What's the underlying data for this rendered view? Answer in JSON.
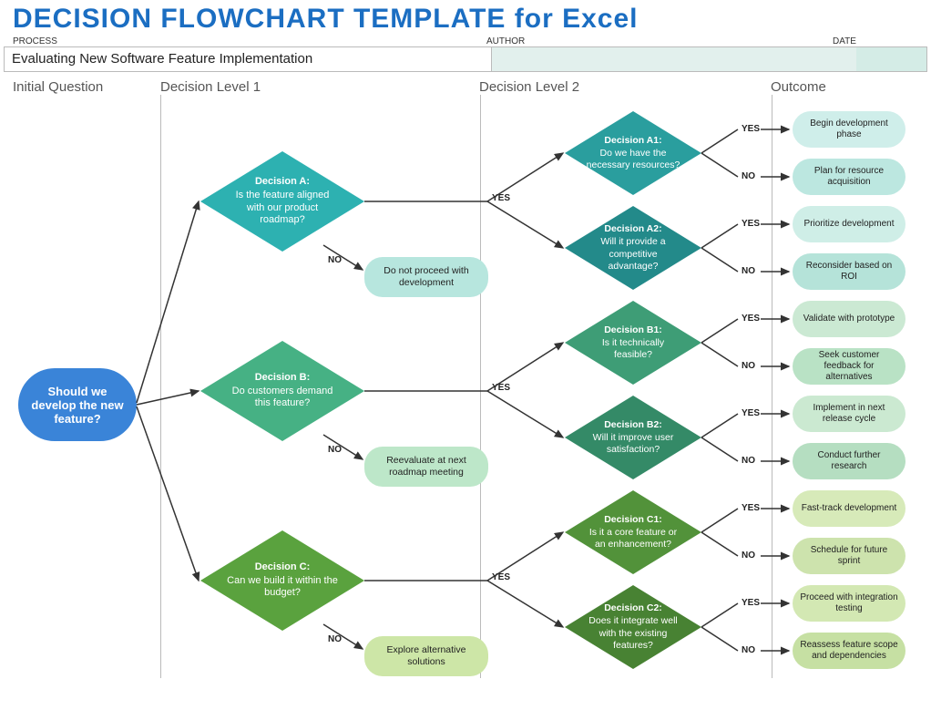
{
  "title_main": "DECISION FLOWCHART TEMPLATE",
  "title_for": "for Excel",
  "labels": {
    "process": "PROCESS",
    "author": "AUTHOR",
    "date": "DATE"
  },
  "fields": {
    "process": "Evaluating New Software Feature Implementation",
    "author": "",
    "date": ""
  },
  "sections": {
    "initial": "Initial Question",
    "l1": "Decision Level 1",
    "l2": "Decision Level 2",
    "outcome": "Outcome"
  },
  "initial_question": "Should we develop the new feature?",
  "decisions_l1": {
    "A": {
      "title": "Decision A:",
      "text": "Is the feature aligned with our product roadmap?",
      "no_outcome": "Do not proceed with development"
    },
    "B": {
      "title": "Decision B:",
      "text": "Do customers demand this feature?",
      "no_outcome": "Reevaluate at next roadmap meeting"
    },
    "C": {
      "title": "Decision C:",
      "text": "Can we build it within the budget?",
      "no_outcome": "Explore alternative solutions"
    }
  },
  "decisions_l2": {
    "A1": {
      "title": "Decision A1:",
      "text": "Do we have the necessary resources?"
    },
    "A2": {
      "title": "Decision A2:",
      "text": "Will it provide a competitive advantage?"
    },
    "B1": {
      "title": "Decision B1:",
      "text": "Is it technically feasible?"
    },
    "B2": {
      "title": "Decision B2:",
      "text": "Will it improve user satisfaction?"
    },
    "C1": {
      "title": "Decision C1:",
      "text": "Is it a core feature or an enhancement?"
    },
    "C2": {
      "title": "Decision C2:",
      "text": "Does it integrate well with the existing features?"
    }
  },
  "outcomes": {
    "A1y": "Begin development phase",
    "A1n": "Plan for resource acquisition",
    "A2y": "Prioritize development",
    "A2n": "Reconsider based on ROI",
    "B1y": "Validate with prototype",
    "B1n": "Seek customer feedback for alternatives",
    "B2y": "Implement in next release cycle",
    "B2n": "Conduct further research",
    "C1y": "Fast-track development",
    "C1n": "Schedule for future sprint",
    "C2y": "Proceed with integration testing",
    "C2n": "Reassess feature scope and dependencies"
  },
  "yn": {
    "yes": "YES",
    "no": "NO"
  },
  "colors": {
    "A": "#2db1b1",
    "A_no": "#b7e6de",
    "A1": "#2a9e9e",
    "A2": "#238a8a",
    "A1y_pill": "#cfeeea",
    "A1n_pill": "#bce7e0",
    "A2y_pill": "#cfeee7",
    "A2n_pill": "#b5e3d9",
    "B": "#46b184",
    "B_no": "#bde7c9",
    "B1": "#3e9d76",
    "B2": "#348a67",
    "B1y_pill": "#cbe9d3",
    "B1n_pill": "#b9e2c5",
    "B2y_pill": "#cbe9d1",
    "B2n_pill": "#b5dec1",
    "C": "#5aa23e",
    "C_no": "#cde6a7",
    "C1": "#52923a",
    "C2": "#488233",
    "C1y_pill": "#d7eab9",
    "C1n_pill": "#cde3ad",
    "C2y_pill": "#d3e8b3",
    "C2n_pill": "#c6e0a3"
  }
}
